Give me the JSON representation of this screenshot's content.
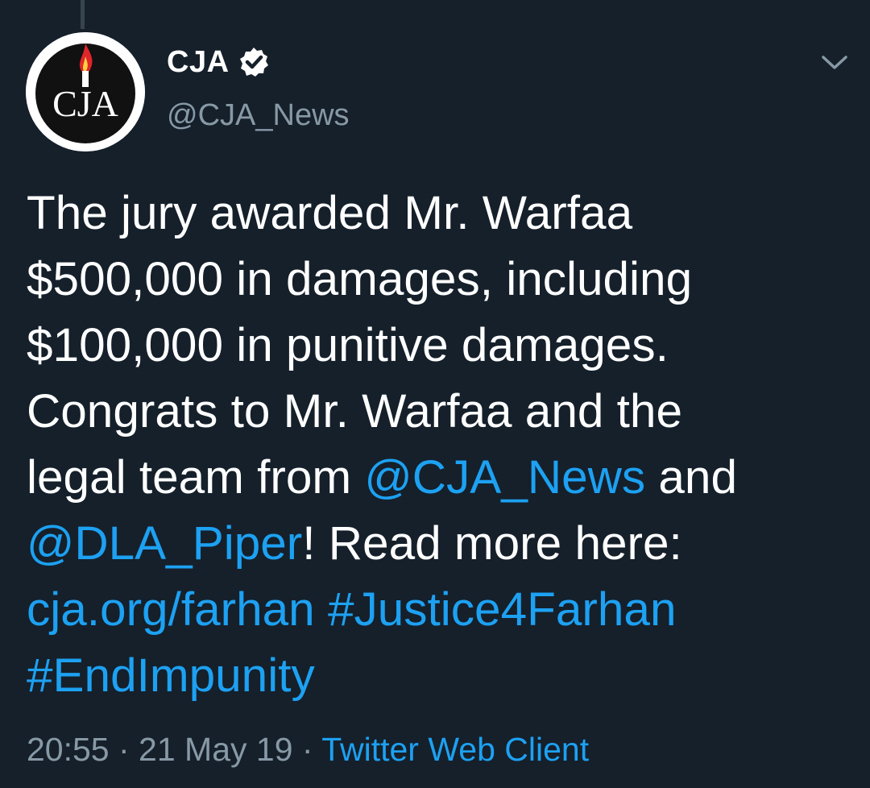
{
  "colors": {
    "background": "#15202b",
    "text": "#ffffff",
    "secondary_text": "#8899a6",
    "link": "#1da1f2",
    "thread_line": "#38444d"
  },
  "tweet": {
    "avatar": {
      "text": "CJA",
      "icon": "cja-logo-flame-icon"
    },
    "display_name": "CJA",
    "verified_icon": "verified-badge-icon",
    "handle": "@CJA_News",
    "menu_icon": "chevron-down-icon",
    "body": {
      "line1": "The jury awarded Mr. Warfaa",
      "line2": "$500,000 in damages, including",
      "line3": "$100,000 in punitive damages.",
      "line4": "Congrats to Mr. Warfaa and the",
      "line5_prefix": "legal team from ",
      "mention1": "@CJA_News",
      "line5_suffix": " and",
      "mention2": "@DLA_Piper",
      "line6_suffix": "! Read more here:",
      "url": "cja.org/farhan",
      "space": " ",
      "hashtag1": "#Justice4Farhan",
      "hashtag2": "#EndImpunity"
    },
    "meta": {
      "time": "20:55",
      "separator": " · ",
      "date": "21 May 19",
      "source": "Twitter Web Client"
    }
  }
}
